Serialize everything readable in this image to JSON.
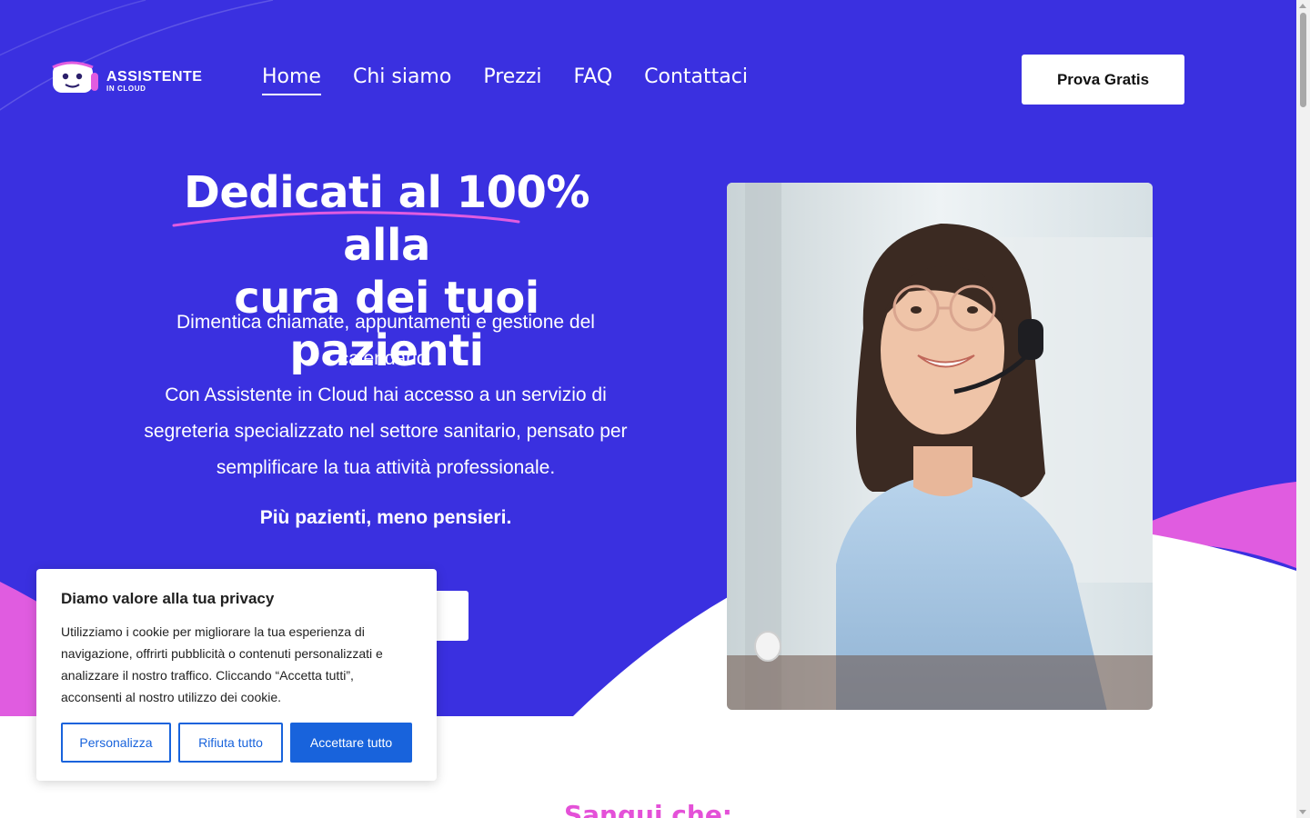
{
  "brand": {
    "name": "ASSISTENTE",
    "sub": "IN CLOUD",
    "icon": "robot-headset-icon",
    "colors": {
      "hero": "#3a30e0",
      "accent": "#e05ce0",
      "cookie_button": "#1863dc"
    }
  },
  "nav": {
    "items": [
      {
        "label": "Home",
        "active": true
      },
      {
        "label": "Chi siamo",
        "active": false
      },
      {
        "label": "Prezzi",
        "active": false
      },
      {
        "label": "FAQ",
        "active": false
      },
      {
        "label": "Contattaci",
        "active": false
      }
    ],
    "cta": "Prova Gratis"
  },
  "hero": {
    "headline_line1": "Dedicati al 100% alla",
    "headline_line2": "cura dei tuoi pazienti",
    "paragraph1": "Dimentica chiamate, appuntamenti e gestione del calendario.",
    "paragraph2": "Con Assistente in Cloud hai accesso a un servizio di segreteria specializzato nel settore sanitario, pensato per semplificare la tua attività professionale.",
    "tagline": "Più pazienti, meno pensieri."
  },
  "next_section": {
    "title_peek": "Sangui che:"
  },
  "cookie": {
    "title": "Diamo valore alla tua privacy",
    "text": "Utilizziamo i cookie per migliorare la tua esperienza di navigazione, offrirti pubblicità o contenuti personalizzati e analizzare il nostro traffico. Cliccando “Accetta tutti”, acconsenti al nostro utilizzo dei cookie.",
    "customize": "Personalizza",
    "reject": "Rifiuta tutto",
    "accept": "Accettare tutto"
  }
}
